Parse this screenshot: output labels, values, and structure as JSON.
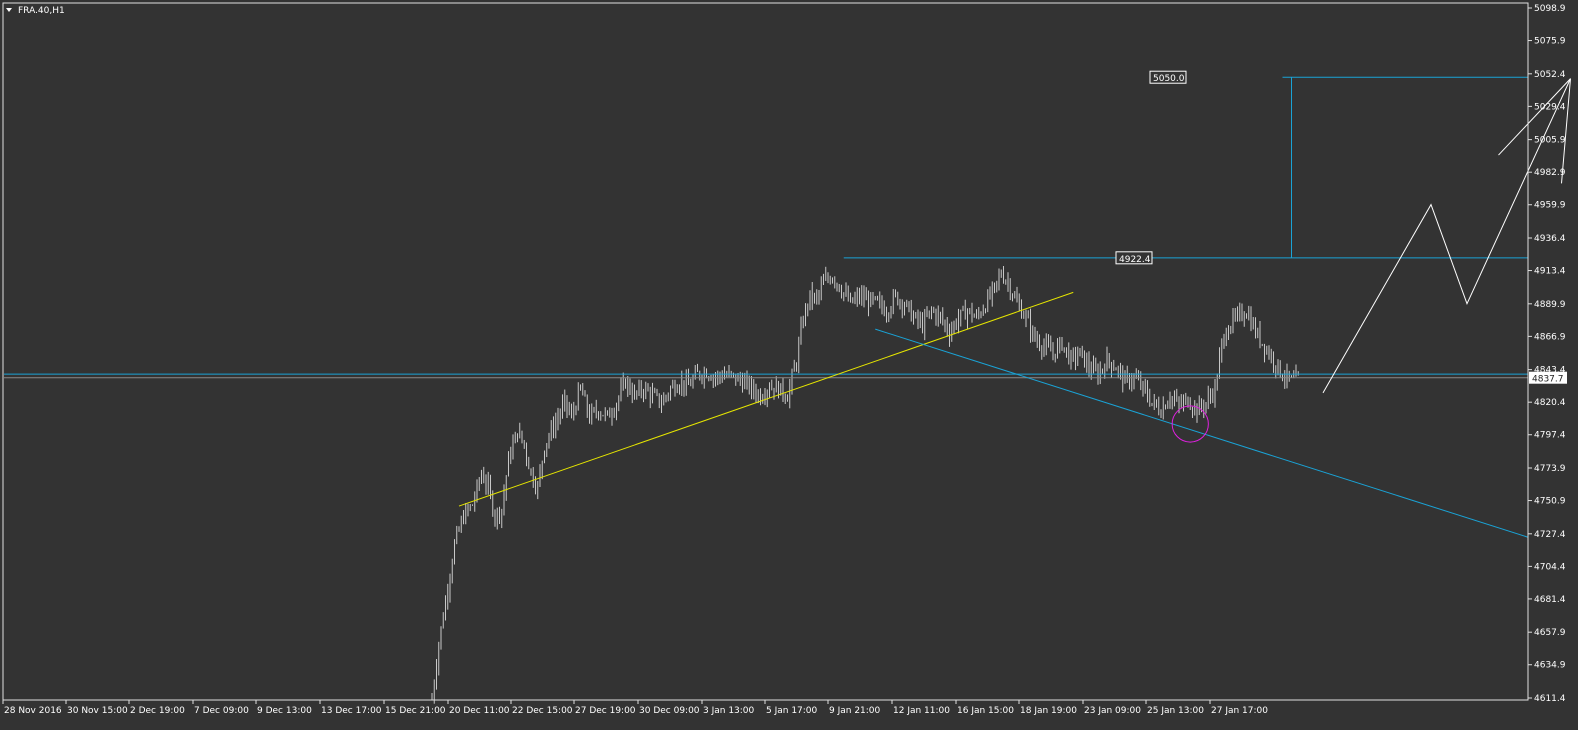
{
  "symbol_label": "FRA.40,H1",
  "symbol_menu_icon": "triangle-down-icon",
  "colors": {
    "background": "#333333",
    "frame": "#e0e0e0",
    "candles": "#c8c8c8",
    "trend_yellow": "#e6e600",
    "trend_blue": "#1aa3d6",
    "projection": "#ffffff",
    "circle": "#e020e0",
    "price_tag_bg": "#ffffff",
    "price_tag_fg": "#222222",
    "label_fg": "#ffffff"
  },
  "chart_data": {
    "type": "bar",
    "title": "FRA.40,H1",
    "y_axis": {
      "min": 4611.4,
      "max": 5098.9,
      "ticks": [
        "5098.9",
        "5075.9",
        "5052.4",
        "5029.4",
        "5005.9",
        "4982.9",
        "4959.9",
        "4936.4",
        "4913.4",
        "4889.9",
        "4866.9",
        "4843.4",
        "4820.4",
        "4797.4",
        "4773.9",
        "4750.9",
        "4727.4",
        "4704.4",
        "4681.4",
        "4657.9",
        "4634.9",
        "4611.4"
      ]
    },
    "x_axis": {
      "ticks": [
        "28 Nov 2016",
        "30 Nov 15:00",
        "2 Dec 19:00",
        "7 Dec 09:00",
        "9 Dec 13:00",
        "13 Dec 17:00",
        "15 Dec 21:00",
        "20 Dec 11:00",
        "22 Dec 15:00",
        "27 Dec 19:00",
        "30 Dec 09:00",
        "3 Jan 13:00",
        "5 Jan 17:00",
        "9 Jan 21:00",
        "12 Jan 11:00",
        "16 Jan 15:00",
        "18 Jan 19:00",
        "23 Jan 09:00",
        "25 Jan 13:00",
        "27 Jan 17:00"
      ],
      "first_tick_index": 0,
      "bars_per_tick": 28
    },
    "current_price": "4837.7",
    "horizontal_lines": [
      {
        "name": "current-price-line",
        "price": 4837.7,
        "color": "#8a8a8a"
      },
      {
        "name": "support-line",
        "price": 4840.2,
        "color": "#1aa3d6"
      }
    ],
    "price_labels": [
      {
        "name": "target-5050",
        "text": "5050.0",
        "price": 5050.0
      },
      {
        "name": "resistance-4922",
        "text": "4922.4",
        "price": 4922.4
      }
    ],
    "series": [
      {
        "name": "price",
        "waypoints": [
          [
            112,
            4611
          ],
          [
            115,
            4650
          ],
          [
            118,
            4680
          ],
          [
            122,
            4720
          ],
          [
            126,
            4740
          ],
          [
            130,
            4748
          ],
          [
            134,
            4770
          ],
          [
            137,
            4760
          ],
          [
            140,
            4740
          ],
          [
            143,
            4745
          ],
          [
            146,
            4780
          ],
          [
            150,
            4800
          ],
          [
            153,
            4790
          ],
          [
            156,
            4770
          ],
          [
            159,
            4760
          ],
          [
            162,
            4790
          ],
          [
            165,
            4800
          ],
          [
            168,
            4810
          ],
          [
            171,
            4820
          ],
          [
            174,
            4810
          ],
          [
            178,
            4830
          ],
          [
            182,
            4810
          ],
          [
            186,
            4815
          ],
          [
            190,
            4810
          ],
          [
            194,
            4820
          ],
          [
            198,
            4835
          ],
          [
            202,
            4825
          ],
          [
            206,
            4830
          ],
          [
            210,
            4825
          ],
          [
            214,
            4820
          ],
          [
            218,
            4830
          ],
          [
            222,
            4835
          ],
          [
            226,
            4832
          ],
          [
            230,
            4840
          ],
          [
            234,
            4842
          ],
          [
            238,
            4838
          ],
          [
            242,
            4840
          ],
          [
            246,
            4838
          ],
          [
            250,
            4835
          ],
          [
            254,
            4830
          ],
          [
            258,
            4825
          ],
          [
            262,
            4832
          ],
          [
            266,
            4830
          ],
          [
            270,
            4825
          ],
          [
            274,
            4850
          ],
          [
            277,
            4880
          ],
          [
            280,
            4895
          ],
          [
            283,
            4893
          ],
          [
            286,
            4905
          ],
          [
            290,
            4910
          ],
          [
            294,
            4900
          ],
          [
            298,
            4890
          ],
          [
            302,
            4895
          ],
          [
            306,
            4892
          ],
          [
            310,
            4890
          ],
          [
            314,
            4885
          ],
          [
            318,
            4895
          ],
          [
            322,
            4890
          ],
          [
            326,
            4880
          ],
          [
            330,
            4875
          ],
          [
            334,
            4885
          ],
          [
            338,
            4880
          ],
          [
            342,
            4870
          ],
          [
            346,
            4880
          ],
          [
            350,
            4885
          ],
          [
            354,
            4880
          ],
          [
            358,
            4890
          ],
          [
            362,
            4900
          ],
          [
            365,
            4912
          ],
          [
            368,
            4905
          ],
          [
            372,
            4890
          ],
          [
            376,
            4880
          ],
          [
            380,
            4865
          ],
          [
            384,
            4860
          ],
          [
            388,
            4855
          ],
          [
            392,
            4862
          ],
          [
            396,
            4850
          ],
          [
            400,
            4855
          ],
          [
            404,
            4845
          ],
          [
            408,
            4840
          ],
          [
            412,
            4850
          ],
          [
            416,
            4845
          ],
          [
            420,
            4835
          ],
          [
            424,
            4838
          ],
          [
            428,
            4830
          ],
          [
            432,
            4820
          ],
          [
            436,
            4815
          ],
          [
            440,
            4825
          ],
          [
            444,
            4818
          ],
          [
            448,
            4822
          ],
          [
            452,
            4815
          ],
          [
            456,
            4820
          ],
          [
            460,
            4830
          ],
          [
            463,
            4860
          ],
          [
            466,
            4875
          ],
          [
            470,
            4880
          ],
          [
            474,
            4885
          ],
          [
            478,
            4870
          ],
          [
            482,
            4860
          ],
          [
            486,
            4850
          ],
          [
            490,
            4840
          ],
          [
            494,
            4835
          ],
          [
            498,
            4837.7
          ]
        ]
      }
    ],
    "trendlines": [
      {
        "name": "yellow-uptrend",
        "from": [
          124,
          4747
        ],
        "to": [
          397,
          4898
        ]
      },
      {
        "name": "blue-downtrend",
        "from": [
          309,
          4872
        ],
        "to": [
          630,
          4725
        ]
      },
      {
        "name": "resistance-line",
        "from": [
          295,
          4922.4
        ],
        "to": [
          630,
          4922.4
        ]
      },
      {
        "name": "target-line",
        "from": [
          490,
          5050
        ],
        "to": [
          628,
          5050
        ]
      },
      {
        "name": "target-vertical",
        "from": [
          494,
          4922.4
        ],
        "to": [
          494,
          5050
        ]
      }
    ],
    "projection": [
      [
        508,
        4827
      ],
      [
        556,
        4960
      ],
      [
        572,
        4890
      ],
      [
        618,
        5049
      ],
      [
        614,
        4975
      ]
    ],
    "projection_wing": [
      [
        586,
        4995
      ],
      [
        618,
        5049
      ]
    ],
    "highlight_circle": {
      "center": [
        449,
        4805
      ],
      "radius_bars": 7
    }
  }
}
